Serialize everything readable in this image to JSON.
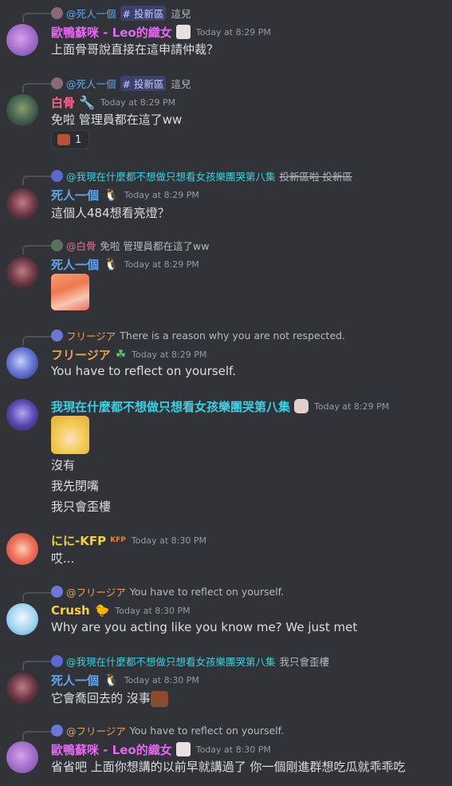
{
  "messages": [
    {
      "reply": {
        "name": "@死人一個",
        "channel": "# 投新區",
        "text": "這兒"
      },
      "user": "歐鴨蘇咪 - Leo的織女",
      "time": "Today at 8:29 PM",
      "lines": [
        "上面骨哥說直接在這申請仲裁？"
      ]
    },
    {
      "reply": {
        "name": "@死人一個",
        "channel": "# 投新區",
        "text": "這兒"
      },
      "user": "白骨",
      "time": "Today at 8:29 PM",
      "lines": [
        "免啦 管理員都在這了ww"
      ],
      "reaction_count": "1"
    },
    {
      "reply": {
        "name": "@我現在什麼都不想做只想看女孩樂團哭第八集",
        "text": "投新區啦 投新區"
      },
      "user": "死人一個",
      "time": "Today at 8:29 PM",
      "lines": [
        "這個人484想看亮燈？"
      ]
    },
    {
      "reply": {
        "name": "@白骨",
        "text": "免啦 管理員都在這了ww"
      },
      "user": "死人一個",
      "time": "Today at 8:29 PM",
      "lines": []
    },
    {
      "reply": {
        "name": "フリージア",
        "text": "There is a reason why you are not respected."
      },
      "user": "フリージア",
      "time": "Today at 8:29 PM",
      "lines": [
        "You have to reflect on yourself."
      ]
    },
    {
      "user": "我現在什麼都不想做只想看女孩樂團哭第八集",
      "time": "Today at 8:29 PM",
      "lines": [
        "沒有",
        "我先閉嘴",
        "我只會歪樓"
      ]
    },
    {
      "user": "にに-KFP",
      "badge": "KFP",
      "time": "Today at 8:30 PM",
      "lines": [
        "哎..."
      ]
    },
    {
      "reply": {
        "name": "@フリージア",
        "text": "You have to reflect on yourself."
      },
      "user": "Crush",
      "time": "Today at 8:30 PM",
      "lines": [
        "Why are you acting like you know me? We just met"
      ]
    },
    {
      "reply": {
        "name": "@我現在什麼都不想做只想看女孩樂團哭第八集",
        "text": "我只會歪樓"
      },
      "user": "死人一個",
      "time": "Today at 8:30 PM",
      "lines": [
        "它會喬回去的 沒事"
      ]
    },
    {
      "reply": {
        "name": "@フリージア",
        "text": "You have to reflect on yourself."
      },
      "user": "歐鴨蘇咪 - Leo的織女",
      "time": "Today at 8:30 PM",
      "lines": [
        "省省吧 上面你想講的以前早就講過了 你一個剛進群想吃瓜就乖乖吃"
      ]
    }
  ],
  "colors": {
    "background": "#313338",
    "pink_user": "#e468f0",
    "red_user": "#f06a8b",
    "blue_user": "#5ea8f0",
    "orange_user": "#f0a050",
    "cyan_user": "#3bd1e0",
    "yellow_user": "#f5d040",
    "timestamp": "#949ba4"
  }
}
